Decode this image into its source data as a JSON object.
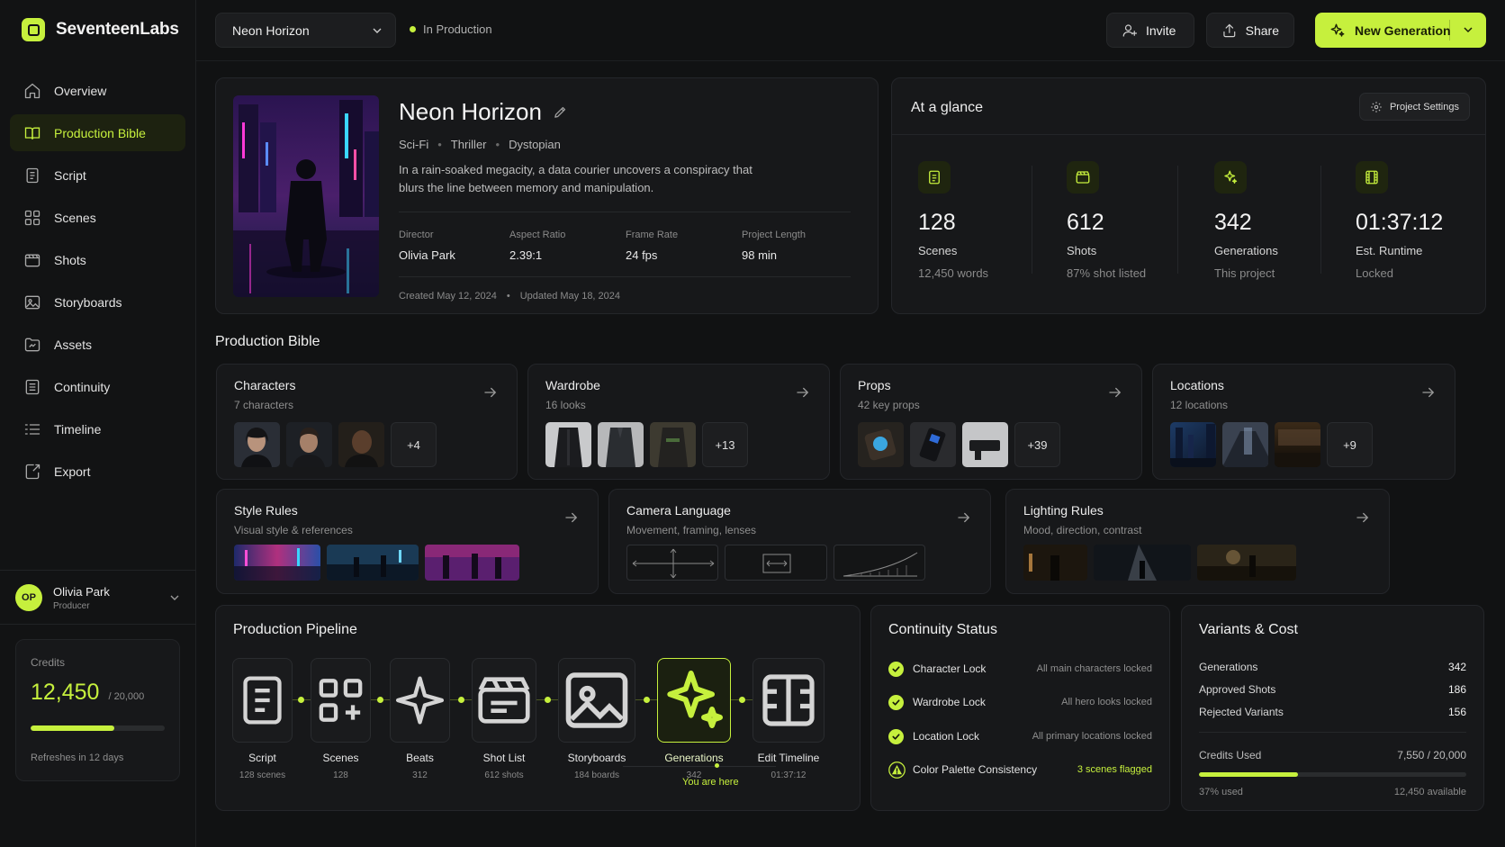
{
  "app": {
    "name": "SeventeenLabs"
  },
  "colors": {
    "accent": "#c6f03d",
    "background": "#111213",
    "card": "#17181a"
  },
  "sidebar": {
    "items": [
      {
        "label": "Overview",
        "icon": "home-icon"
      },
      {
        "label": "Production Bible",
        "icon": "book-icon",
        "active": true
      },
      {
        "label": "Script",
        "icon": "document-icon"
      },
      {
        "label": "Scenes",
        "icon": "scenes-icon"
      },
      {
        "label": "Shots",
        "icon": "shots-icon"
      },
      {
        "label": "Storyboards",
        "icon": "image-icon"
      },
      {
        "label": "Assets",
        "icon": "folder-icon"
      },
      {
        "label": "Continuity",
        "icon": "list-icon"
      },
      {
        "label": "Timeline",
        "icon": "timeline-icon"
      },
      {
        "label": "Export",
        "icon": "export-icon"
      }
    ],
    "user": {
      "initials": "OP",
      "name": "Olivia Park",
      "role": "Producer"
    },
    "credits": {
      "label": "Credits",
      "value": "12,450",
      "max": "/ 20,000",
      "fraction": 0.6225,
      "refresh": "Refreshes in 12 days"
    }
  },
  "topbar": {
    "project": "Neon Horizon",
    "status": "In Production",
    "invite": "Invite",
    "share": "Share",
    "new_generation": "New Generation"
  },
  "project": {
    "title": "Neon Horizon",
    "genres": [
      "Sci-Fi",
      "Thriller",
      "Dystopian"
    ],
    "logline": "In a rain-soaked megacity, a data courier uncovers a conspiracy that blurs the line between memory and manipulation.",
    "meta": [
      {
        "label": "Director",
        "value": "Olivia Park"
      },
      {
        "label": "Aspect Ratio",
        "value": "2.39:1"
      },
      {
        "label": "Frame Rate",
        "value": "24 fps"
      },
      {
        "label": "Project Length",
        "value": "98 min"
      }
    ],
    "created": "Created May 12, 2024",
    "updated": "Updated May 18, 2024"
  },
  "glance": {
    "title": "At a glance",
    "settings": "Project Settings",
    "stats": [
      {
        "value": "128",
        "label": "Scenes",
        "sub": "12,450 words",
        "icon": "document-icon"
      },
      {
        "value": "612",
        "label": "Shots",
        "sub": "87% shot listed",
        "icon": "clapper-icon"
      },
      {
        "value": "342",
        "label": "Generations",
        "sub": "This project",
        "icon": "sparkle-icon"
      },
      {
        "value": "01:37:12",
        "label": "Est. Runtime",
        "sub": "Locked",
        "icon": "film-icon"
      }
    ]
  },
  "bible": {
    "title": "Production Bible",
    "cards": [
      {
        "title": "Characters",
        "sub": "7 characters",
        "more": "+4"
      },
      {
        "title": "Wardrobe",
        "sub": "16 looks",
        "more": "+13"
      },
      {
        "title": "Props",
        "sub": "42 key props",
        "more": "+39"
      },
      {
        "title": "Locations",
        "sub": "12 locations",
        "more": "+9"
      }
    ],
    "cards2": [
      {
        "title": "Style Rules",
        "sub": "Visual style & references"
      },
      {
        "title": "Camera Language",
        "sub": "Movement, framing, lenses"
      },
      {
        "title": "Lighting Rules",
        "sub": "Mood, direction, contrast"
      }
    ]
  },
  "pipeline": {
    "title": "Production Pipeline",
    "steps": [
      {
        "name": "Script",
        "count": "128 scenes",
        "icon": "document-icon"
      },
      {
        "name": "Scenes",
        "count": "128",
        "icon": "scenes-icon"
      },
      {
        "name": "Beats",
        "count": "312",
        "icon": "sparkle-icon"
      },
      {
        "name": "Shot List",
        "count": "612 shots",
        "icon": "clapper-icon"
      },
      {
        "name": "Storyboards",
        "count": "184 boards",
        "icon": "image-icon"
      },
      {
        "name": "Generations",
        "count": "342",
        "icon": "sparkle-icon",
        "current": true
      },
      {
        "name": "Edit Timeline",
        "count": "01:37:12",
        "icon": "film-icon"
      }
    ],
    "here": "You are here"
  },
  "continuity": {
    "title": "Continuity Status",
    "rows": [
      {
        "name": "Character Lock",
        "status": "All main characters locked",
        "ok": true
      },
      {
        "name": "Wardrobe Lock",
        "status": "All hero looks locked",
        "ok": true
      },
      {
        "name": "Location Lock",
        "status": "All primary locations locked",
        "ok": true
      },
      {
        "name": "Color Palette Consistency",
        "status": "3 scenes flagged",
        "ok": false
      }
    ]
  },
  "variants": {
    "title": "Variants & Cost",
    "rows": [
      {
        "label": "Generations",
        "value": "342"
      },
      {
        "label": "Approved Shots",
        "value": "186"
      },
      {
        "label": "Rejected Variants",
        "value": "156"
      }
    ],
    "credits_used_label": "Credits Used",
    "credits_used_value": "7,550 / 20,000",
    "used_fraction": 0.37,
    "used_pct": "37% used",
    "available": "12,450 available"
  }
}
